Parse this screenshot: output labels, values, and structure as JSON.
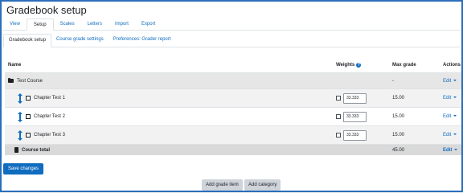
{
  "page": {
    "title": "Gradebook setup"
  },
  "tabs": [
    {
      "label": "View",
      "active": false
    },
    {
      "label": "Setup",
      "active": true
    },
    {
      "label": "Scales",
      "active": false
    },
    {
      "label": "Letters",
      "active": false
    },
    {
      "label": "Import",
      "active": false
    },
    {
      "label": "Export",
      "active": false
    }
  ],
  "subtabs": [
    {
      "label": "Gradebook setup",
      "active": true
    },
    {
      "label": "Course grade settings",
      "active": false
    },
    {
      "label": "Preferences: Grader report",
      "active": false
    }
  ],
  "table": {
    "headers": {
      "name": "Name",
      "weights": "Weights",
      "max_grade": "Max grade",
      "actions": "Actions"
    },
    "category": {
      "name": "Test Course",
      "max_grade": "-",
      "action": "Edit"
    },
    "items": [
      {
        "name": "Chapter Test 1",
        "weight": "33.333",
        "max_grade": "15.00",
        "action": "Edit"
      },
      {
        "name": "Chapter Test 2",
        "weight": "33.333",
        "max_grade": "15.00",
        "action": "Edit"
      },
      {
        "name": "Chapter Test 3",
        "weight": "33.333",
        "max_grade": "15.00",
        "action": "Edit"
      }
    ],
    "total": {
      "name": "Course total",
      "max_grade": "45.00",
      "action": "Edit"
    }
  },
  "buttons": {
    "save": "Save changes",
    "add_grade_item": "Add grade item",
    "add_category": "Add category"
  },
  "icons": {
    "weights_help": "question-circle-icon",
    "category": "folder-icon",
    "move": "move-icon",
    "item": "grade-item-icon",
    "total": "calculator-icon"
  },
  "colors": {
    "accent": "#0f6cbf",
    "frame": "#2a6ebb",
    "category_bg": "#e6e6e6",
    "total_bg": "#d9d9d9"
  }
}
